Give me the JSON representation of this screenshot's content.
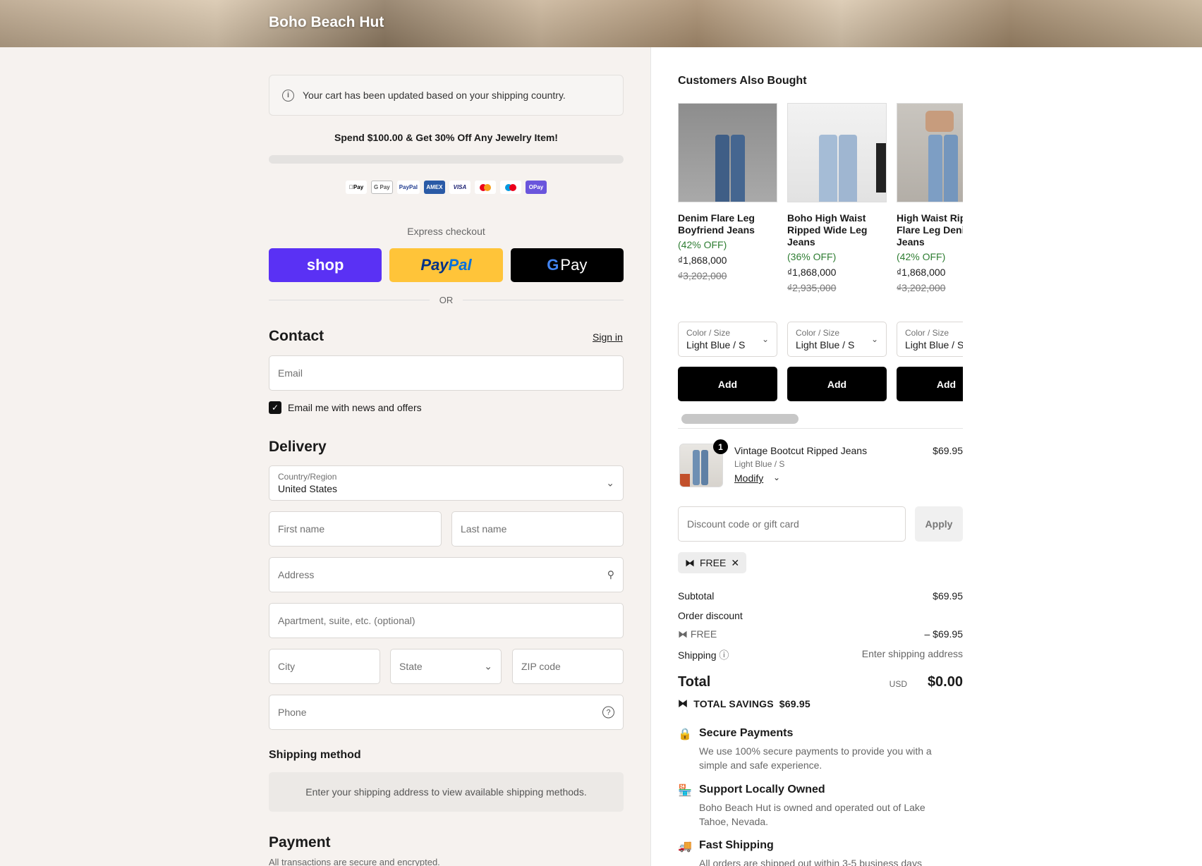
{
  "header": {
    "brand": "Boho Beach Hut"
  },
  "notice": {
    "text": "Your cart has been updated based on your shipping country."
  },
  "promo": {
    "text": "Spend $100.00 & Get 30% Off Any Jewelry Item!",
    "progress": 0
  },
  "payment_icons": [
    {
      "icon": "apple-pay-icon",
      "label": "Pay"
    },
    {
      "icon": "google-pay-icon",
      "label": "G Pay"
    },
    {
      "icon": "paypal-icon",
      "label": "PayPal"
    },
    {
      "icon": "amex-icon",
      "label": "AMEX"
    },
    {
      "icon": "visa-icon",
      "label": "VISA"
    },
    {
      "icon": "mastercard-icon",
      "label": ""
    },
    {
      "icon": "maestro-icon",
      "label": ""
    },
    {
      "icon": "opay-icon",
      "label": "OPay"
    }
  ],
  "express": {
    "label": "Express checkout",
    "shop_label": "shop",
    "paypal_label_a": "Pay",
    "paypal_label_b": "Pal",
    "gpay_g": "G",
    "gpay_label": "Pay",
    "or_label": "OR"
  },
  "contact": {
    "title": "Contact",
    "signin": "Sign in",
    "email_placeholder": "Email",
    "news_label": "Email me with news and offers",
    "news_checked": true
  },
  "delivery": {
    "title": "Delivery",
    "country_label": "Country/Region",
    "country_value": "United States",
    "first_name": "First name",
    "last_name": "Last name",
    "address": "Address",
    "apartment": "Apartment, suite, etc. (optional)",
    "city": "City",
    "state": "State",
    "zip": "ZIP code",
    "phone": "Phone"
  },
  "shipping_method": {
    "title": "Shipping method",
    "message": "Enter your shipping address to view available shipping methods."
  },
  "payment": {
    "title": "Payment",
    "subtitle": "All transactions are secure and encrypted."
  },
  "recommendations": {
    "title": "Customers Also Bought",
    "items": [
      {
        "name": "Denim Flare Leg Boyfriend Jeans",
        "discount": "(42% OFF)",
        "price": "₫1,868,000",
        "old_price": "₫3,202,000",
        "select_label": "Color / Size",
        "select_value": "Light Blue / S",
        "add_label": "Add"
      },
      {
        "name": "Boho High Waist Ripped Wide Leg Jeans",
        "discount": "(36% OFF)",
        "price": "₫1,868,000",
        "old_price": "₫2,935,000",
        "select_label": "Color / Size",
        "select_value": "Light Blue / S",
        "add_label": "Add"
      },
      {
        "name": "High Waist Ripped Flare Leg Denim Jeans",
        "discount": "(42% OFF)",
        "price": "₫1,868,000",
        "old_price": "₫3,202,000",
        "select_label": "Color / Size",
        "select_value": "Light Blue / S",
        "add_label": "Add"
      }
    ]
  },
  "cart_item": {
    "quantity": "1",
    "name": "Vintage Bootcut Ripped Jeans",
    "variant": "Light Blue / S",
    "modify": "Modify",
    "price": "$69.95"
  },
  "discount": {
    "placeholder": "Discount code or gift card",
    "apply": "Apply",
    "applied_code": "FREE"
  },
  "summary": {
    "subtotal_label": "Subtotal",
    "subtotal_value": "$69.95",
    "order_discount_label": "Order discount",
    "discount_code": "FREE",
    "discount_value": "– $69.95",
    "shipping_label": "Shipping",
    "shipping_value": "Enter shipping address",
    "total_label": "Total",
    "currency": "USD",
    "total_value": "$0.00",
    "savings_label": "TOTAL SAVINGS",
    "savings_value": "$69.95"
  },
  "features": [
    {
      "icon": "lock-icon",
      "title": "Secure Payments",
      "desc": "We use 100% secure payments to provide you with a simple and safe experience."
    },
    {
      "icon": "store-icon",
      "title": "Support Locally Owned",
      "desc": "Boho Beach Hut is owned and operated out of Lake Tahoe, Nevada."
    },
    {
      "icon": "truck-icon",
      "title": "Fast Shipping",
      "desc": "All orders are shipped out within 3-5 business days"
    }
  ],
  "colors": {
    "shop_pay": "#5a31f4",
    "paypal": "#ffc439",
    "discount_green": "#2e7d32"
  }
}
